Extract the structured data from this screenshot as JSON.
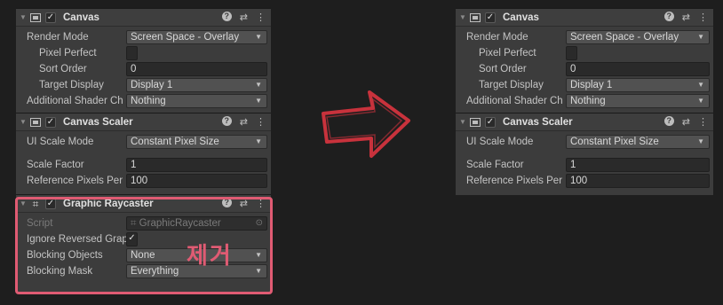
{
  "left": {
    "canvas": {
      "title": "Canvas",
      "render_mode_label": "Render Mode",
      "render_mode_value": "Screen Space - Overlay",
      "pixel_perfect_label": "Pixel Perfect",
      "sort_order_label": "Sort Order",
      "sort_order_value": "0",
      "target_display_label": "Target Display",
      "target_display_value": "Display 1",
      "additional_shader_label": "Additional Shader Ch",
      "additional_shader_value": "Nothing"
    },
    "scaler": {
      "title": "Canvas Scaler",
      "ui_scale_mode_label": "UI Scale Mode",
      "ui_scale_mode_value": "Constant Pixel Size",
      "scale_factor_label": "Scale Factor",
      "scale_factor_value": "1",
      "ref_pixels_label": "Reference Pixels Per",
      "ref_pixels_value": "100"
    },
    "raycaster": {
      "title": "Graphic Raycaster",
      "script_label": "Script",
      "script_value": "GraphicRaycaster",
      "ignore_reversed_label": "Ignore Reversed Grap",
      "blocking_objects_label": "Blocking Objects",
      "blocking_objects_value": "None",
      "blocking_mask_label": "Blocking Mask",
      "blocking_mask_value": "Everything"
    },
    "annotation": "제거"
  },
  "right": {
    "canvas": {
      "title": "Canvas",
      "render_mode_label": "Render Mode",
      "render_mode_value": "Screen Space - Overlay",
      "pixel_perfect_label": "Pixel Perfect",
      "sort_order_label": "Sort Order",
      "sort_order_value": "0",
      "target_display_label": "Target Display",
      "target_display_value": "Display 1",
      "additional_shader_label": "Additional Shader Ch",
      "additional_shader_value": "Nothing"
    },
    "scaler": {
      "title": "Canvas Scaler",
      "ui_scale_mode_label": "UI Scale Mode",
      "ui_scale_mode_value": "Constant Pixel Size",
      "scale_factor_label": "Scale Factor",
      "scale_factor_value": "1",
      "ref_pixels_label": "Reference Pixels Per",
      "ref_pixels_value": "100"
    }
  },
  "colors": {
    "panel_bg": "#3c3c3c",
    "page_bg": "#1e1e1e",
    "highlight": "#e05b73",
    "arrow": "#c8323c"
  }
}
